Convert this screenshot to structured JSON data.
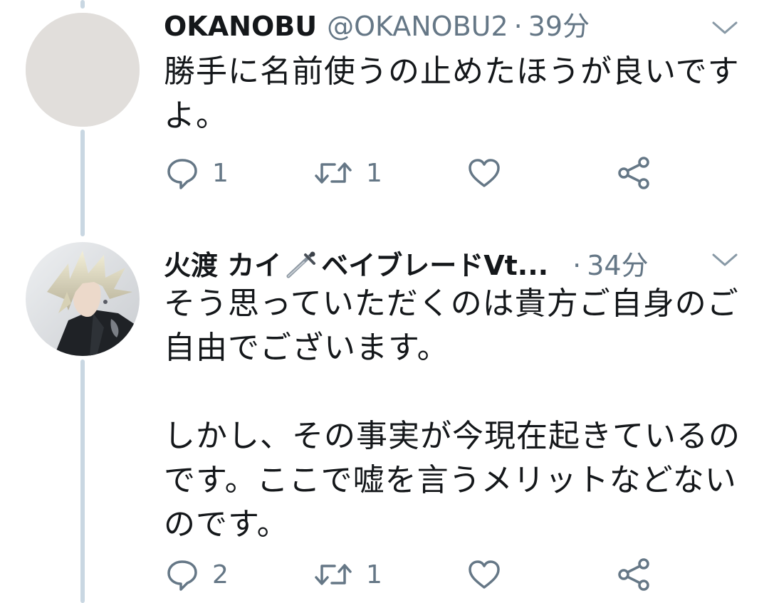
{
  "tweets": [
    {
      "display_name": "OKANOBU",
      "handle": "@OKANOBU2",
      "separator": "·",
      "time": "39分",
      "avatar": "blank-avatar",
      "body": [
        "勝手に名前使うの止めたほうが良いです",
        "よ。"
      ],
      "actions": {
        "reply_icon": "reply-icon",
        "reply_count": "1",
        "retweet_icon": "retweet-icon",
        "retweet_count": "1",
        "like_icon": "heart-icon",
        "share_icon": "share-icon"
      }
    },
    {
      "display_name": "火渡 カイ",
      "display_name_suffix": "ベイブレードVt...",
      "name_emoji": "dagger-icon",
      "separator": "·",
      "time": "34分",
      "avatar": "anime-character-avatar",
      "body": [
        "そう思っていただくのは貴方ご自身のご",
        "自由でございます。",
        "",
        "しかし、その事実が今現在起きているの",
        "です。ここで嘘を言うメリットなどない",
        "のです。"
      ],
      "actions": {
        "reply_icon": "reply-icon",
        "reply_count": "2",
        "retweet_icon": "retweet-icon",
        "retweet_count": "1",
        "like_icon": "heart-icon",
        "share_icon": "share-icon"
      }
    }
  ],
  "colors": {
    "text": "#14171a",
    "secondary": "#657786",
    "thread_line": "#c9d7e2",
    "background": "#ffffff"
  }
}
